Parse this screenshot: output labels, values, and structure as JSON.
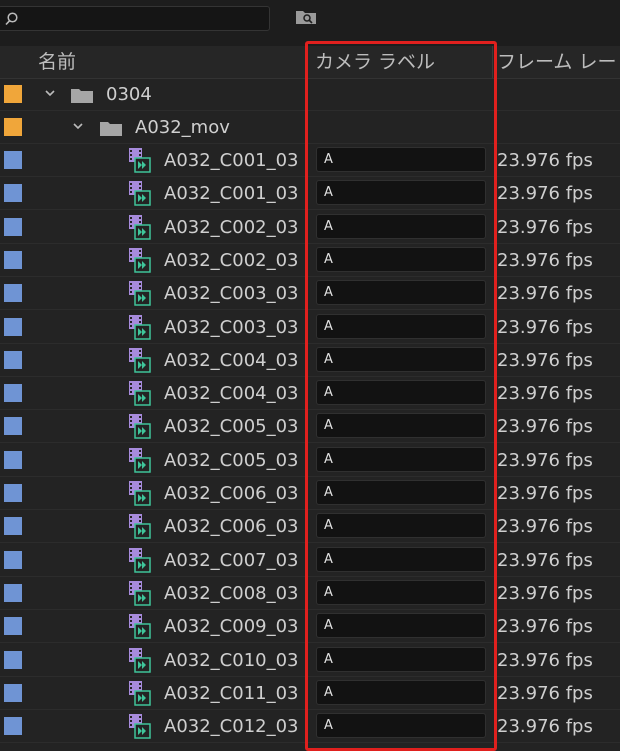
{
  "search": {
    "placeholder": "",
    "value": ""
  },
  "columns": {
    "name": "名前",
    "camera_label": "カメラ ラベル",
    "frame_rate": "フレーム レー"
  },
  "colors": {
    "bin_swatch": "#f0a63a",
    "clip_swatch": "#6f94d4",
    "highlight": "#e0201e"
  },
  "bins": [
    {
      "name": "0304",
      "icon": "folder-icon",
      "expanded": true
    },
    {
      "name": "A032_mov",
      "icon": "folder-icon",
      "expanded": true
    }
  ],
  "clips": [
    {
      "name": "A032_C001_03",
      "camera_label": "A",
      "fps": "23.976 fps"
    },
    {
      "name": "A032_C001_03",
      "camera_label": "A",
      "fps": "23.976 fps"
    },
    {
      "name": "A032_C002_03",
      "camera_label": "A",
      "fps": "23.976 fps"
    },
    {
      "name": "A032_C002_03",
      "camera_label": "A",
      "fps": "23.976 fps"
    },
    {
      "name": "A032_C003_03",
      "camera_label": "A",
      "fps": "23.976 fps"
    },
    {
      "name": "A032_C003_03",
      "camera_label": "A",
      "fps": "23.976 fps"
    },
    {
      "name": "A032_C004_03",
      "camera_label": "A",
      "fps": "23.976 fps"
    },
    {
      "name": "A032_C004_03",
      "camera_label": "A",
      "fps": "23.976 fps"
    },
    {
      "name": "A032_C005_03",
      "camera_label": "A",
      "fps": "23.976 fps"
    },
    {
      "name": "A032_C005_03",
      "camera_label": "A",
      "fps": "23.976 fps"
    },
    {
      "name": "A032_C006_03",
      "camera_label": "A",
      "fps": "23.976 fps"
    },
    {
      "name": "A032_C006_03",
      "camera_label": "A",
      "fps": "23.976 fps"
    },
    {
      "name": "A032_C007_03",
      "camera_label": "A",
      "fps": "23.976 fps"
    },
    {
      "name": "A032_C008_03",
      "camera_label": "A",
      "fps": "23.976 fps"
    },
    {
      "name": "A032_C009_03",
      "camera_label": "A",
      "fps": "23.976 fps"
    },
    {
      "name": "A032_C010_03",
      "camera_label": "A",
      "fps": "23.976 fps"
    },
    {
      "name": "A032_C011_03",
      "camera_label": "A",
      "fps": "23.976 fps"
    },
    {
      "name": "A032_C012_03",
      "camera_label": "A",
      "fps": "23.976 fps"
    }
  ]
}
